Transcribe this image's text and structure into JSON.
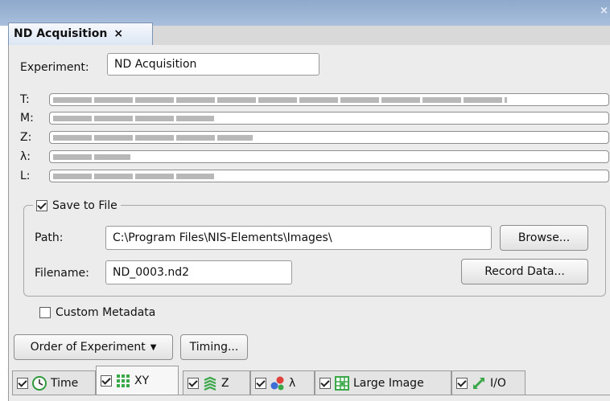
{
  "window": {
    "close_glyph": "×"
  },
  "doc_tab": {
    "title": "ND Acquisition",
    "close": "×"
  },
  "experiment": {
    "label": "Experiment:",
    "value": "ND Acquisition"
  },
  "dimensions": [
    {
      "label": "T:",
      "fill_fraction": 0.82
    },
    {
      "label": "M:",
      "fill_fraction": 0.29
    },
    {
      "label": "Z:",
      "fill_fraction": 0.36
    },
    {
      "label": "λ:",
      "fill_fraction": 0.14
    },
    {
      "label": "L:",
      "fill_fraction": 0.29
    }
  ],
  "save": {
    "checkbox_label": "Save to File",
    "checked": true,
    "path_label": "Path:",
    "path_value": "C:\\Program Files\\NIS-Elements\\Images\\",
    "browse_label": "Browse...",
    "filename_label": "Filename:",
    "filename_value": "ND_0003.nd2",
    "record_label": "Record Data..."
  },
  "custom_metadata": {
    "label": "Custom Metadata",
    "checked": false
  },
  "buttons": {
    "order": "Order of Experiment",
    "order_caret": "▼",
    "timing": "Timing..."
  },
  "tabs": [
    {
      "label": "Time",
      "icon": "clock-icon",
      "checked": true
    },
    {
      "label": "XY",
      "icon": "grid-icon",
      "checked": true
    },
    {
      "label": "Z",
      "icon": "layers-icon",
      "checked": true
    },
    {
      "label": "λ",
      "icon": "molecule-icon",
      "checked": true
    },
    {
      "label": "Large Image",
      "icon": "large-image-icon",
      "checked": true
    },
    {
      "label": "I/O",
      "icon": "io-arrows-icon",
      "checked": true
    }
  ],
  "colors": {
    "titlebar": "#8ea9cc",
    "panel": "#ececec",
    "bar_fill": "#b8b8b8"
  }
}
